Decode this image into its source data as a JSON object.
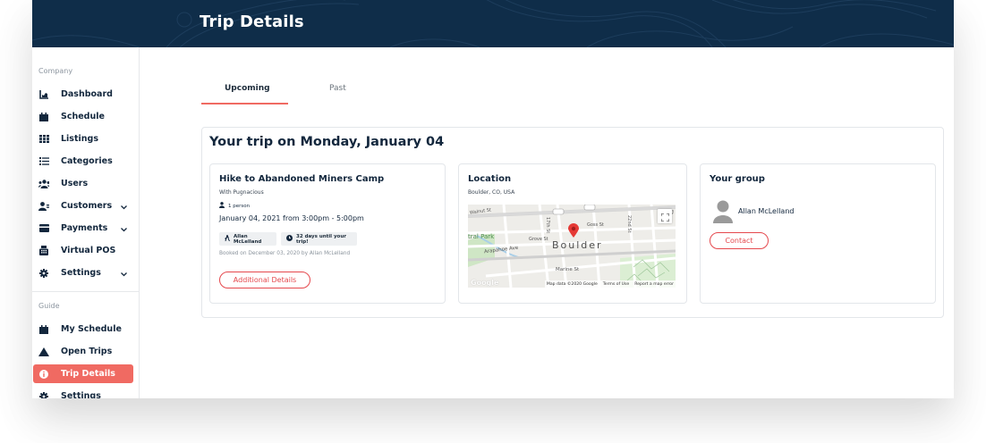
{
  "header": {
    "title": "Trip Details"
  },
  "sidebar": {
    "company_label": "Company",
    "guide_label": "Guide",
    "company_items": [
      {
        "label": "Dashboard",
        "icon": "chart-icon"
      },
      {
        "label": "Schedule",
        "icon": "calendar-icon"
      },
      {
        "label": "Listings",
        "icon": "grid-icon"
      },
      {
        "label": "Categories",
        "icon": "list-icon"
      },
      {
        "label": "Users",
        "icon": "users-icon"
      },
      {
        "label": "Customers",
        "icon": "customer-icon"
      },
      {
        "label": "Payments",
        "icon": "credit-card-icon"
      },
      {
        "label": "Virtual POS",
        "icon": "pos-icon"
      },
      {
        "label": "Settings",
        "icon": "gear-icon"
      }
    ],
    "guide_items": [
      {
        "label": "My Schedule",
        "icon": "calendar-icon"
      },
      {
        "label": "Open Trips",
        "icon": "mountain-icon"
      },
      {
        "label": "Trip Details",
        "icon": "info-icon",
        "active": true
      },
      {
        "label": "Settings",
        "icon": "gear-icon"
      }
    ]
  },
  "tabs": [
    {
      "label": "Upcoming",
      "active": true
    },
    {
      "label": "Past",
      "active": false
    }
  ],
  "trip": {
    "heading": "Your trip on Monday, January 04",
    "activity": {
      "title": "Hike to Abandoned Miners Camp",
      "with": "With Pugnacious",
      "people": "1 person",
      "datetime": "January 04, 2021 from 3:00pm - 5:00pm",
      "guide_tag": "Allan McLelland",
      "countdown_tag": "32 days until your trip!",
      "booked": "Booked on December 03, 2020 by Allan McLelland",
      "details_button": "Additional Details"
    },
    "location": {
      "title": "Location",
      "address": "Boulder, CO, USA",
      "map": {
        "city": "Boulder",
        "streets": [
          "Walnut St",
          "Pearl St",
          "Grove St",
          "Arapahoe Ave",
          "Marine St",
          "Goss St",
          "17th St",
          "19th St",
          "18th St",
          "22nd St",
          "Folsom St",
          "16th St",
          "15th St",
          "119"
        ],
        "park": "tral Park",
        "copyright": "Map data ©2020 Google",
        "terms": "Terms of Use",
        "report": "Report a map error",
        "brand": "Google"
      }
    },
    "group": {
      "title": "Your group",
      "member": "Allan McLelland",
      "contact_button": "Contact"
    }
  },
  "colors": {
    "header_bg": "#0f2d49",
    "accent": "#f06a62",
    "button_red": "#e5484d",
    "map_pin": "#e53935"
  }
}
